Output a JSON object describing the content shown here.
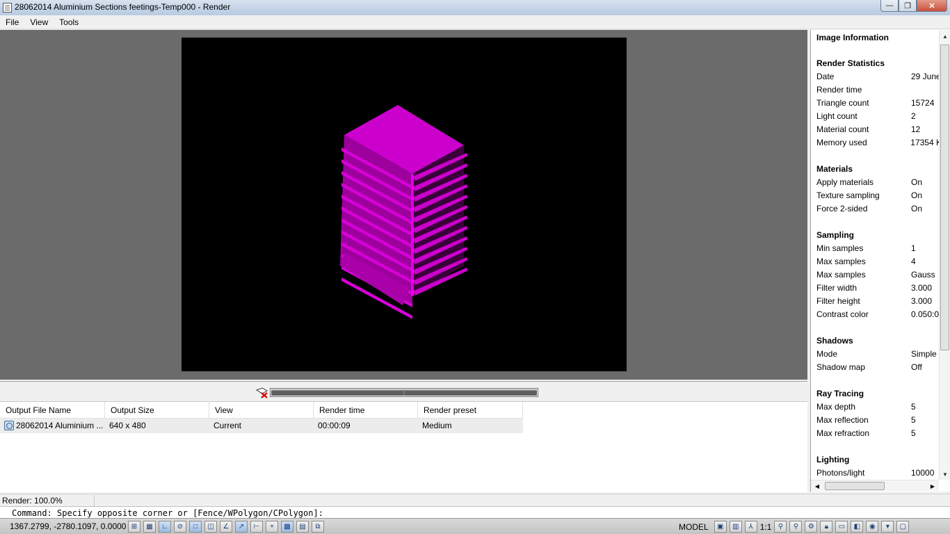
{
  "window": {
    "title": "28062014 Aluminium Sections feetings-Temp000 - Render",
    "minimize_glyph": "—",
    "restore_glyph": "❐",
    "close_glyph": "✕"
  },
  "menu": [
    "File",
    "View",
    "Tools"
  ],
  "history": {
    "headers": [
      "Output File Name",
      "Output Size",
      "View",
      "Render time",
      "Render preset"
    ],
    "rows": [
      [
        "28062014 Aluminium ...",
        "640 x 480",
        "Current",
        "00:00:09",
        "Medium"
      ]
    ]
  },
  "progress": {
    "fraction": 1.0
  },
  "info": {
    "title": "Image Information",
    "sections": [
      {
        "heading": "Render Statistics",
        "rows": [
          [
            "Date",
            "29 June"
          ],
          [
            "Render time",
            ""
          ],
          [
            "Triangle count",
            "15724"
          ],
          [
            "Light count",
            "2"
          ],
          [
            "Material count",
            "12"
          ],
          [
            "Memory used",
            "17354 K"
          ]
        ]
      },
      {
        "heading": "Materials",
        "rows": [
          [
            "Apply materials",
            "On"
          ],
          [
            "Texture sampling",
            "On"
          ],
          [
            "Force 2-sided",
            "On"
          ]
        ]
      },
      {
        "heading": "Sampling",
        "rows": [
          [
            "Min samples",
            "1"
          ],
          [
            "Max samples",
            "4"
          ],
          [
            "Max samples",
            "Gauss"
          ],
          [
            "Filter width",
            "3.000"
          ],
          [
            "Filter height",
            "3.000"
          ],
          [
            "Contrast color",
            "0.050:0"
          ]
        ]
      },
      {
        "heading": "Shadows",
        "rows": [
          [
            "Mode",
            "Simple"
          ],
          [
            "Shadow map",
            "Off"
          ]
        ]
      },
      {
        "heading": "Ray Tracing",
        "rows": [
          [
            "Max depth",
            "5"
          ],
          [
            "Max reflection",
            "5"
          ],
          [
            "Max refraction",
            "5"
          ]
        ]
      },
      {
        "heading": "Lighting",
        "rows": [
          [
            "Photons/light",
            "10000"
          ]
        ]
      }
    ]
  },
  "status": {
    "render": "Render: 100.0%",
    "command": "Command: Specify opposite corner or [Fence/WPolygon/CPolygon]:",
    "coords": "1367.2799,  -2780.1097, 0.0000",
    "model": "MODEL",
    "scale": "1:1"
  },
  "colors": {
    "render_bg": "#6b6b6b",
    "object": "#cc00cc"
  },
  "icons": [
    "app-icon",
    "cancel-render-icon",
    "file-output-icon",
    "snap-icon",
    "grid-icon",
    "ortho-icon",
    "polar-icon",
    "osnap-icon",
    "otrack-icon",
    "ducs-icon",
    "dyn-icon",
    "lwt-icon",
    "tpy-icon",
    "qp-icon",
    "sc-icon",
    "layout-icon",
    "annotation-icon",
    "workspace-icon",
    "lock-icon",
    "isolate-icon",
    "lightbulb-icon"
  ]
}
